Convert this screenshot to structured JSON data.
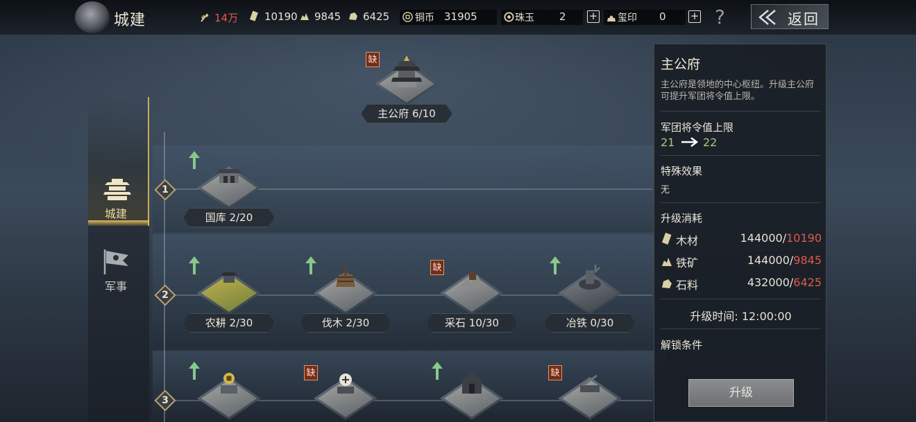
{
  "header": {
    "title": "城建",
    "resources": {
      "grain": "14万",
      "wood": "10190",
      "iron": "9845",
      "stone": "6425"
    },
    "currency": {
      "copper_label": "铜币",
      "copper_value": "31905",
      "jade_label": "珠玉",
      "jade_value": "2",
      "seal_label": "玺印",
      "seal_value": "0"
    },
    "help": "?",
    "back_label": "返回"
  },
  "nav": {
    "items": [
      {
        "label": "城建",
        "active": true
      },
      {
        "label": "军事",
        "active": false
      }
    ]
  },
  "tree": {
    "root": {
      "name": "主公府",
      "level": "6/10",
      "lacking": true,
      "lack_label": "缺"
    },
    "tiers": [
      "1",
      "2",
      "3"
    ],
    "buildings": [
      {
        "name": "国库",
        "level": "2/20",
        "tier": 1,
        "upgradable": true,
        "lacking": false
      },
      {
        "name": "农耕",
        "level": "2/30",
        "tier": 2,
        "upgradable": true,
        "lacking": false
      },
      {
        "name": "伐木",
        "level": "2/30",
        "tier": 2,
        "upgradable": true,
        "lacking": false
      },
      {
        "name": "采石",
        "level": "10/30",
        "tier": 2,
        "upgradable": false,
        "lacking": true
      },
      {
        "name": "冶铁",
        "level": "0/30",
        "tier": 2,
        "upgradable": true,
        "lacking": false
      },
      {
        "name": "",
        "level": "",
        "tier": 3,
        "upgradable": true,
        "lacking": false
      },
      {
        "name": "",
        "level": "",
        "tier": 3,
        "upgradable": false,
        "lacking": true
      },
      {
        "name": "",
        "level": "",
        "tier": 3,
        "upgradable": true,
        "lacking": false
      },
      {
        "name": "",
        "level": "",
        "tier": 3,
        "upgradable": false,
        "lacking": true
      }
    ],
    "lack_label": "缺"
  },
  "detail": {
    "title": "主公府",
    "description": "主公府是领地的中心枢纽。升级主公府可提升军团将令值上限。",
    "stat_heading": "军团将令值上限",
    "stat_from": "21",
    "stat_to": "22",
    "special_heading": "特殊效果",
    "special_value": "无",
    "cost_heading": "升级消耗",
    "costs": [
      {
        "name": "木材",
        "need": "144000",
        "have": "10190"
      },
      {
        "name": "铁矿",
        "need": "144000",
        "have": "9845"
      },
      {
        "name": "石料",
        "need": "432000",
        "have": "6425"
      }
    ],
    "cost_separator": "/",
    "time_label": "升级时间:",
    "time_value": "12:00:00",
    "unlock_heading": "解锁条件",
    "upgrade_button": "升级"
  },
  "colors": {
    "insufficient": "#e05a4a",
    "gain": "#a9c67e",
    "active_nav": "#e6be5a",
    "upgrade_arrow": "#86c98a"
  }
}
